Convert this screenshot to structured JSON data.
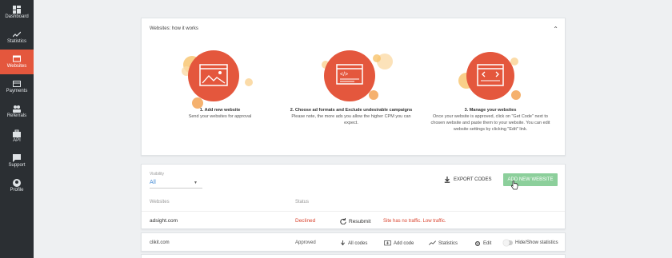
{
  "sidebar": {
    "items": [
      {
        "label": "Dashboard",
        "icon": "dashboard-icon",
        "active": false
      },
      {
        "label": "Statistics",
        "icon": "statistics-icon",
        "active": false
      },
      {
        "label": "Websites",
        "icon": "websites-icon",
        "active": true
      },
      {
        "label": "Payments",
        "icon": "payments-icon",
        "active": false
      },
      {
        "label": "Referrals",
        "icon": "referrals-icon",
        "active": false
      },
      {
        "label": "API",
        "icon": "api-icon",
        "active": false
      },
      {
        "label": "Support",
        "icon": "support-icon",
        "active": false
      },
      {
        "label": "Profile",
        "icon": "profile-icon",
        "active": false
      }
    ]
  },
  "how_it_works": {
    "title": "Websites: how it works",
    "steps": [
      {
        "title": "1. Add new website",
        "text": "Send your websites for approval"
      },
      {
        "title": "2. Choose ad formats and Exclude undesirable campaigns",
        "text": "Please note, the more ads you allow the higher CPM you can expect."
      },
      {
        "title": "3. Manage your websites",
        "text": "Once your website is approved, click on \"Get Code\" next to chosen website and paste them to your website. You can edit website settings by clicking \"Edit\" link."
      }
    ]
  },
  "list": {
    "filter_label": "Visibility",
    "filter_value": "All",
    "export_label": "EXPORT CODES",
    "add_label": "ADD NEW WEBSITE",
    "col_websites": "Websites",
    "col_status": "Status",
    "rows": [
      {
        "site": "adsight.com",
        "status": "Declined",
        "action": "Resubmit",
        "reason": "Site has no traffic. Low traffic."
      }
    ]
  },
  "row2": {
    "site": "clikit.com",
    "status": "Approved",
    "get_codes": "All codes",
    "add_code": "Add code",
    "statistics": "Statistics",
    "edit": "Edit",
    "toggle_label": "Hide/Show statistics"
  },
  "colors": {
    "accent": "#e4573d",
    "green": "#8ccf9b",
    "sidebar": "#2b2f33"
  }
}
